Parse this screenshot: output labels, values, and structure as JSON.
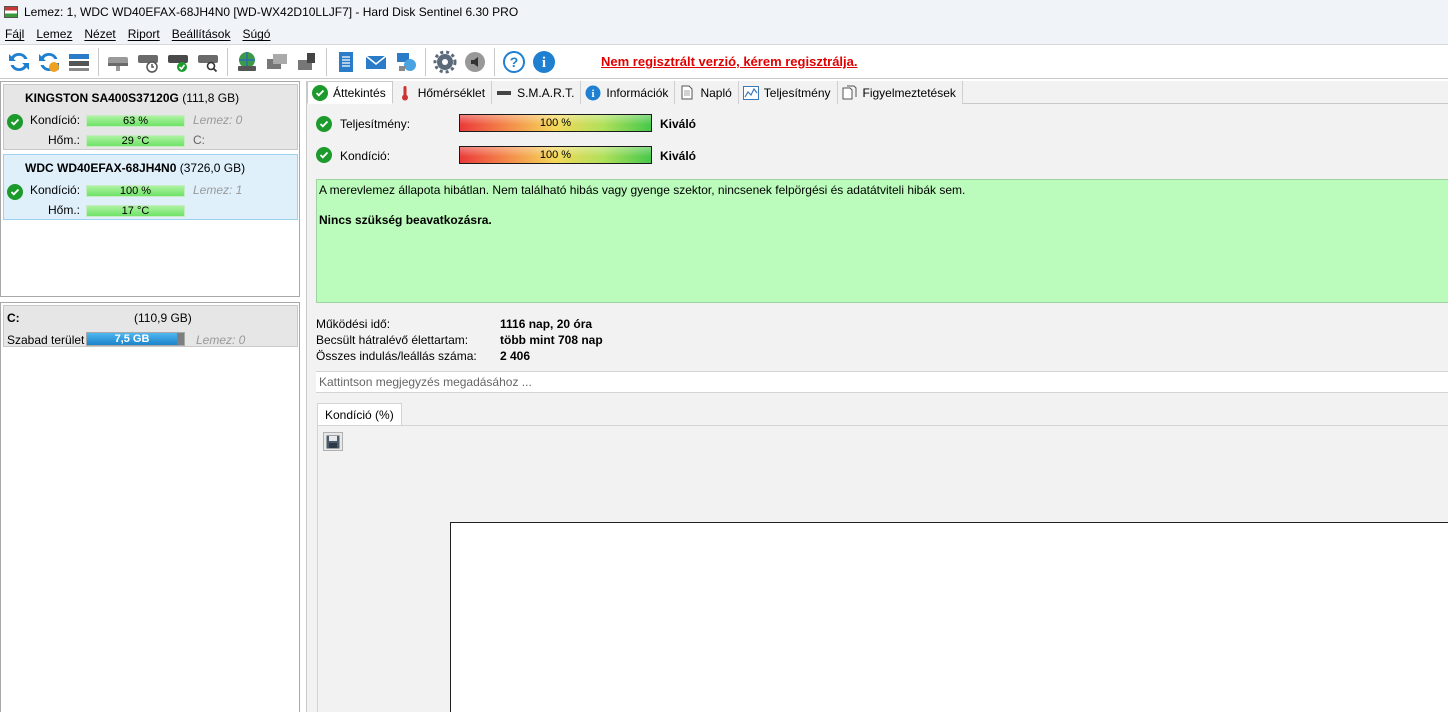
{
  "window": {
    "title": "Lemez: 1, WDC WD40EFAX-68JH4N0 [WD-WX42D10LLJF7]  -  Hard Disk Sentinel 6.30 PRO"
  },
  "menu": [
    "Fájl",
    "Lemez",
    "Nézet",
    "Riport",
    "Beállítások",
    "Súgó"
  ],
  "toolbar": {
    "icons": [
      "refresh-icon",
      "refresh-all-icon",
      "disk-list-icon",
      "hdd-icon",
      "hdd-clock-icon",
      "hdd-check-icon",
      "hdd-search-icon",
      "globe-disk-icon",
      "disk-transfer-icon",
      "disk-tools-icon",
      "notepad-icon",
      "mail-icon",
      "network-icon",
      "gear-icon",
      "speaker-icon",
      "help-icon",
      "info-icon"
    ],
    "registration_warning": "Nem regisztrált verzió, kérem regisztrálja."
  },
  "disks": [
    {
      "name": "KINGSTON SA400S37120G",
      "size": "(111,8 GB)",
      "condition_label": "Kondíció:",
      "condition_value": "63 %",
      "condition_note": "Lemez: 0",
      "temp_label": "Hőm.:",
      "temp_value": "29 °C",
      "temp_note": "C:"
    },
    {
      "name": "WDC WD40EFAX-68JH4N0",
      "size": "(3726,0 GB)",
      "condition_label": "Kondíció:",
      "condition_value": "100 %",
      "condition_note": "Lemez: 1",
      "temp_label": "Hőm.:",
      "temp_value": "17 °C"
    }
  ],
  "volume": {
    "letter": "C:",
    "size": "(110,9 GB)",
    "free_label": "Szabad terület",
    "free_value": "7,5 GB",
    "free_fraction": 0.068,
    "note": "Lemez: 0"
  },
  "tabs": [
    "Áttekintés",
    "Hőmérséklet",
    "S.M.A.R.T.",
    "Információk",
    "Napló",
    "Teljesítmény",
    "Figyelmeztetések"
  ],
  "metrics": {
    "performance_label": "Teljesítmény:",
    "performance_value": "100 %",
    "performance_status": "Kiváló",
    "condition_label": "Kondíció:",
    "condition_value": "100 %",
    "condition_status": "Kiváló"
  },
  "status": {
    "text": "A merevlemez állapota hibátlan. Nem található hibás vagy gyenge szektor, nincsenek felpörgési és adatátviteli hibák sem.",
    "action": "Nincs szükség beavatkozásra."
  },
  "info": [
    {
      "label": "Működési idő:",
      "value": "1116 nap, 20 óra"
    },
    {
      "label": "Becsült hátralévő élettartam:",
      "value": "több mint 708 nap"
    },
    {
      "label": "Összes indulás/leállás száma:",
      "value": "2 406"
    }
  ],
  "note_placeholder": "Kattintson megjegyzés megadásához ...",
  "chart_tab": "Kondíció  (%)",
  "colors": {
    "status_ok": "#1c9a2c",
    "status_box": "#bbfbbb",
    "selected_disk": "#dff0fb",
    "warning": "#e00000"
  }
}
